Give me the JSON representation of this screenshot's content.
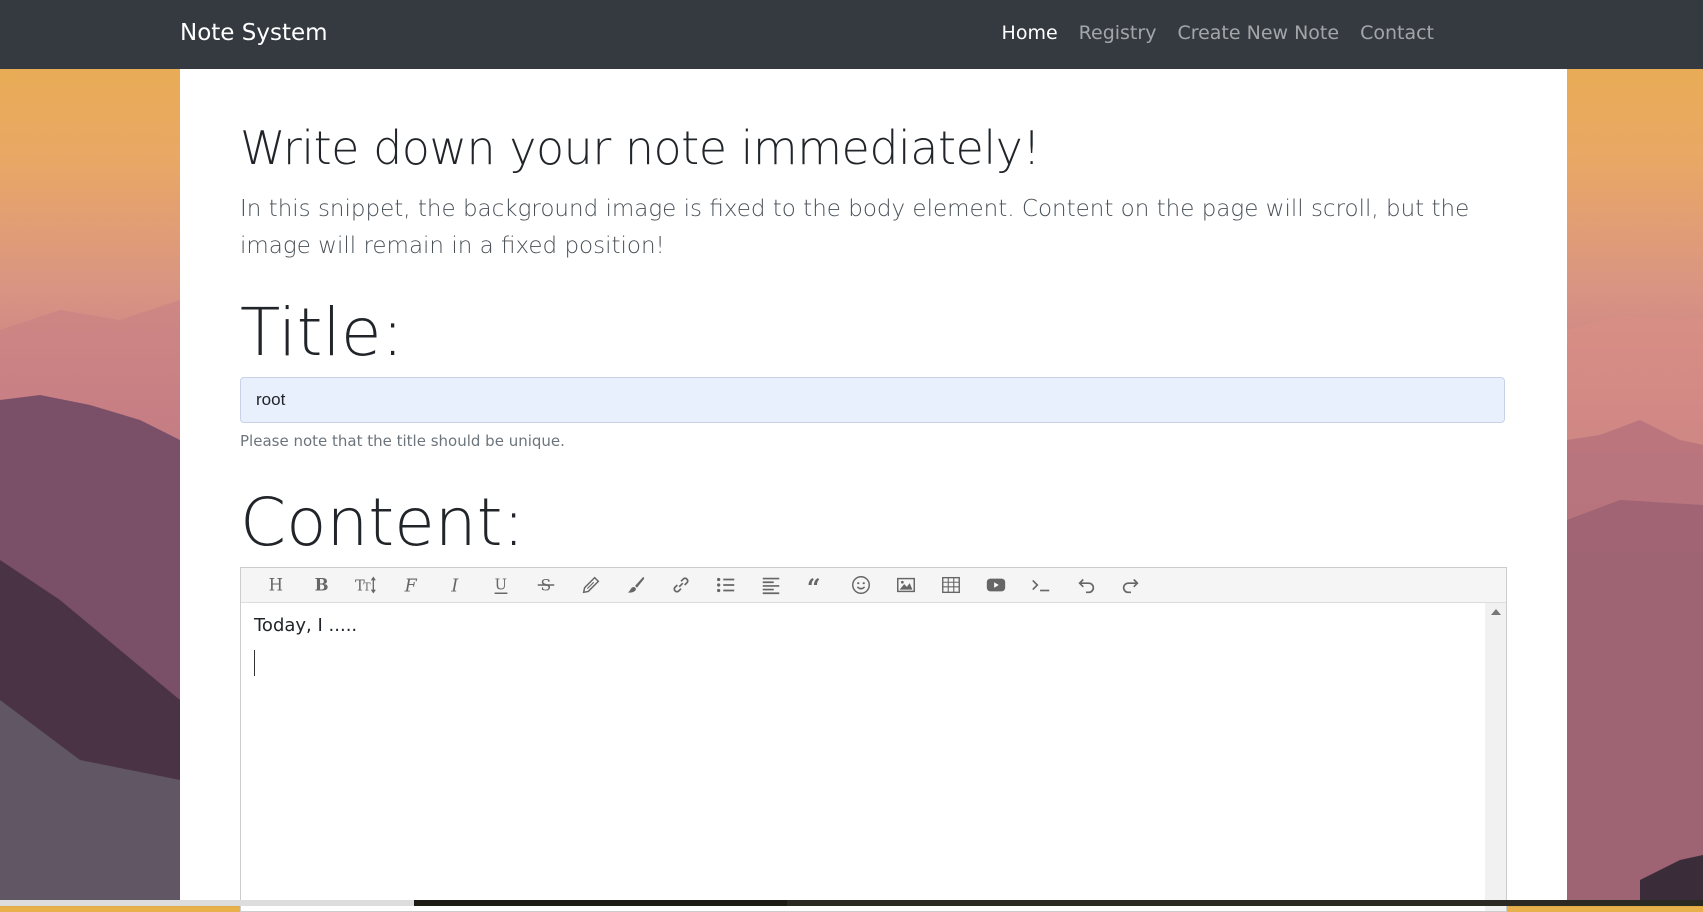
{
  "navbar": {
    "brand": "Note System",
    "links": [
      "Home",
      "Registry",
      "Create New Note",
      "Contact"
    ],
    "active": "Home"
  },
  "main": {
    "heading": "Write down your note immediately!",
    "lead": "In this snippet, the background image is fixed to the body element. Content on the page will scroll, but the image will remain in a fixed position!",
    "title_label": "Title:",
    "title_value": "root",
    "title_help": "Please note that the title should be unique.",
    "content_label": "Content:",
    "content_text": "Today, I ....."
  },
  "toolbar_icons": [
    "heading-icon",
    "bold-icon",
    "font-size-icon",
    "font-family-icon",
    "italic-icon",
    "underline-icon",
    "strikethrough-icon",
    "highlighter-icon",
    "paintbrush-icon",
    "link-icon",
    "bulleted-list-icon",
    "align-left-icon",
    "quote-icon",
    "emoji-icon",
    "image-icon",
    "table-icon",
    "video-icon",
    "code-icon",
    "undo-icon",
    "redo-icon"
  ],
  "colors": {
    "navbar": "#343a40",
    "input_bg": "#e8f0fe"
  }
}
